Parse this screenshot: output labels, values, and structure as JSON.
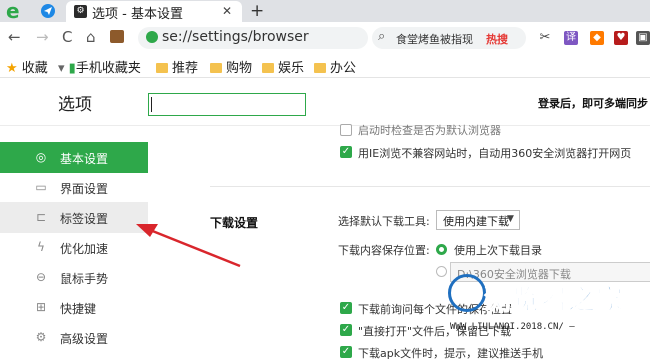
{
  "browser": {
    "tab_title": "选项 - 基本设置",
    "close_glyph": "✕",
    "newtab_glyph": "+",
    "address": "se://settings/browser",
    "search_query": "食堂烤鱼被指现",
    "search_hot_label": "热搜",
    "back_glyph": "←",
    "forward_glyph": "→",
    "reload_glyph": "C",
    "home_glyph": "⌂"
  },
  "bookmarks": {
    "favorites": "收藏",
    "mobile": "手机收藏夹",
    "folders": [
      "推荐",
      "购物",
      "娱乐",
      "办公"
    ]
  },
  "header": {
    "title": "选项",
    "search_value": "",
    "login_hint": "登录后，即可多端同步"
  },
  "sidebar": {
    "items": [
      {
        "label": "基本设置",
        "icon": "gear-icon",
        "glyph": "◎",
        "state": "active"
      },
      {
        "label": "界面设置",
        "icon": "window-icon",
        "glyph": "▭",
        "state": "normal"
      },
      {
        "label": "标签设置",
        "icon": "tab-icon",
        "glyph": "⊏",
        "state": "hover"
      },
      {
        "label": "优化加速",
        "icon": "lightning-icon",
        "glyph": "ϟ",
        "state": "normal"
      },
      {
        "label": "鼠标手势",
        "icon": "mouse-icon",
        "glyph": "⊖",
        "state": "normal"
      },
      {
        "label": "快捷键",
        "icon": "keyboard-icon",
        "glyph": "⊞",
        "state": "normal"
      },
      {
        "label": "高级设置",
        "icon": "sliders-icon",
        "glyph": "⚙",
        "state": "normal"
      }
    ]
  },
  "content": {
    "check_startup_default": "启动时检查是否为默认浏览器",
    "check_ie_incompatible": "用IE浏览不兼容网站时，自动用360安全浏览器打开网页",
    "download_section_title": "下载设置",
    "default_tool_label": "选择默认下载工具:",
    "default_tool_value": "使用内建下载",
    "save_location_label": "下载内容保存位置:",
    "radio_last_dir": "使用上次下载目录",
    "path_value": "D:\\360安全浏览器下载",
    "check_ask_before": "下载前询问每个文件的保存位置",
    "check_direct_open": "\"直接打开\"文件后，保留已下载",
    "check_apk": "下载apk文件时，提示，建议推送手机"
  },
  "watermark": {
    "text": "浏览器之家",
    "url": "WWW.LIULANQI.2018.CN/ —"
  },
  "colors": {
    "accent": "#2ea84a",
    "annotation_arrow": "#d9262c"
  }
}
